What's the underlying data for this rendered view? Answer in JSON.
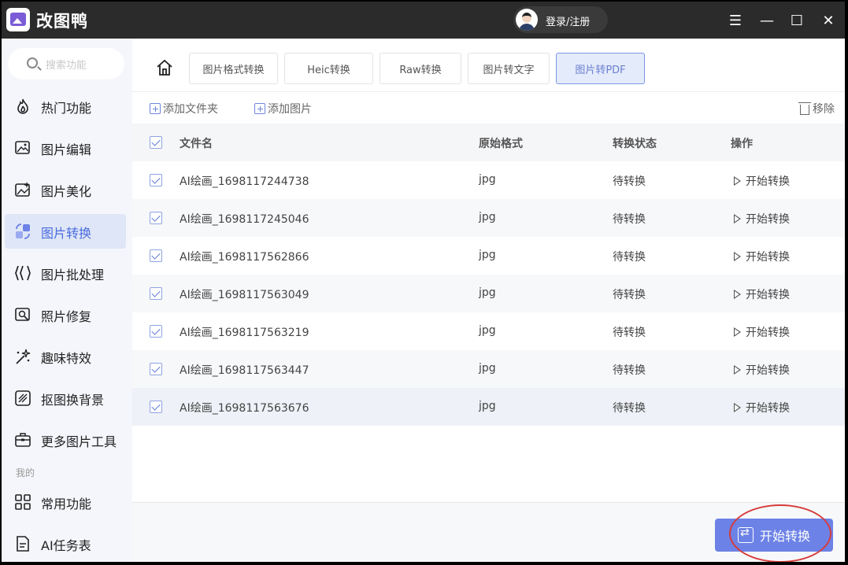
{
  "app": {
    "title": "改图鸭",
    "login_label": "登录/注册"
  },
  "window_controls": {
    "menu": "☰",
    "minimize": "—",
    "maximize": "☐",
    "close": "✕"
  },
  "sidebar": {
    "search_placeholder": "搜索功能",
    "items": [
      {
        "label": "热门功能",
        "icon": "flame-icon"
      },
      {
        "label": "图片编辑",
        "icon": "image-edit-icon"
      },
      {
        "label": "图片美化",
        "icon": "image-beautify-icon"
      },
      {
        "label": "图片转换",
        "icon": "image-convert-icon",
        "active": true
      },
      {
        "label": "图片批处理",
        "icon": "batch-icon"
      },
      {
        "label": "照片修复",
        "icon": "photo-repair-icon"
      },
      {
        "label": "趣味特效",
        "icon": "sparkle-icon"
      },
      {
        "label": "抠图换背景",
        "icon": "cutout-icon"
      },
      {
        "label": "更多图片工具",
        "icon": "toolbox-icon"
      }
    ],
    "section_mine": "我的",
    "mine_items": [
      {
        "label": "常用功能",
        "icon": "grid-icon"
      },
      {
        "label": "AI任务表",
        "icon": "document-icon"
      }
    ]
  },
  "tabs": [
    {
      "label": "图片格式转换"
    },
    {
      "label": "Heic转换"
    },
    {
      "label": "Raw转换"
    },
    {
      "label": "图片转文字"
    },
    {
      "label": "图片转PDF",
      "active": true
    }
  ],
  "toolbar": {
    "add_folder": "添加文件夹",
    "add_image": "添加图片",
    "remove": "移除"
  },
  "table": {
    "headers": {
      "name": "文件名",
      "format": "原始格式",
      "status": "转换状态",
      "action": "操作"
    },
    "rows": [
      {
        "name": "AI绘画_1698117244738",
        "format": "jpg",
        "status": "待转换",
        "action": "开始转换"
      },
      {
        "name": "AI绘画_1698117245046",
        "format": "jpg",
        "status": "待转换",
        "action": "开始转换"
      },
      {
        "name": "AI绘画_1698117562866",
        "format": "jpg",
        "status": "待转换",
        "action": "开始转换"
      },
      {
        "name": "AI绘画_1698117563049",
        "format": "jpg",
        "status": "待转换",
        "action": "开始转换"
      },
      {
        "name": "AI绘画_1698117563219",
        "format": "jpg",
        "status": "待转换",
        "action": "开始转换"
      },
      {
        "name": "AI绘画_1698117563447",
        "format": "jpg",
        "status": "待转换",
        "action": "开始转换"
      },
      {
        "name": "AI绘画_1698117563676",
        "format": "jpg",
        "status": "待转换",
        "action": "开始转换"
      }
    ]
  },
  "footer": {
    "start_button": "开始转换"
  },
  "colors": {
    "accent": "#6c82e6",
    "highlight_ring": "#d63b3b",
    "titlebar": "#2b2b2b"
  }
}
